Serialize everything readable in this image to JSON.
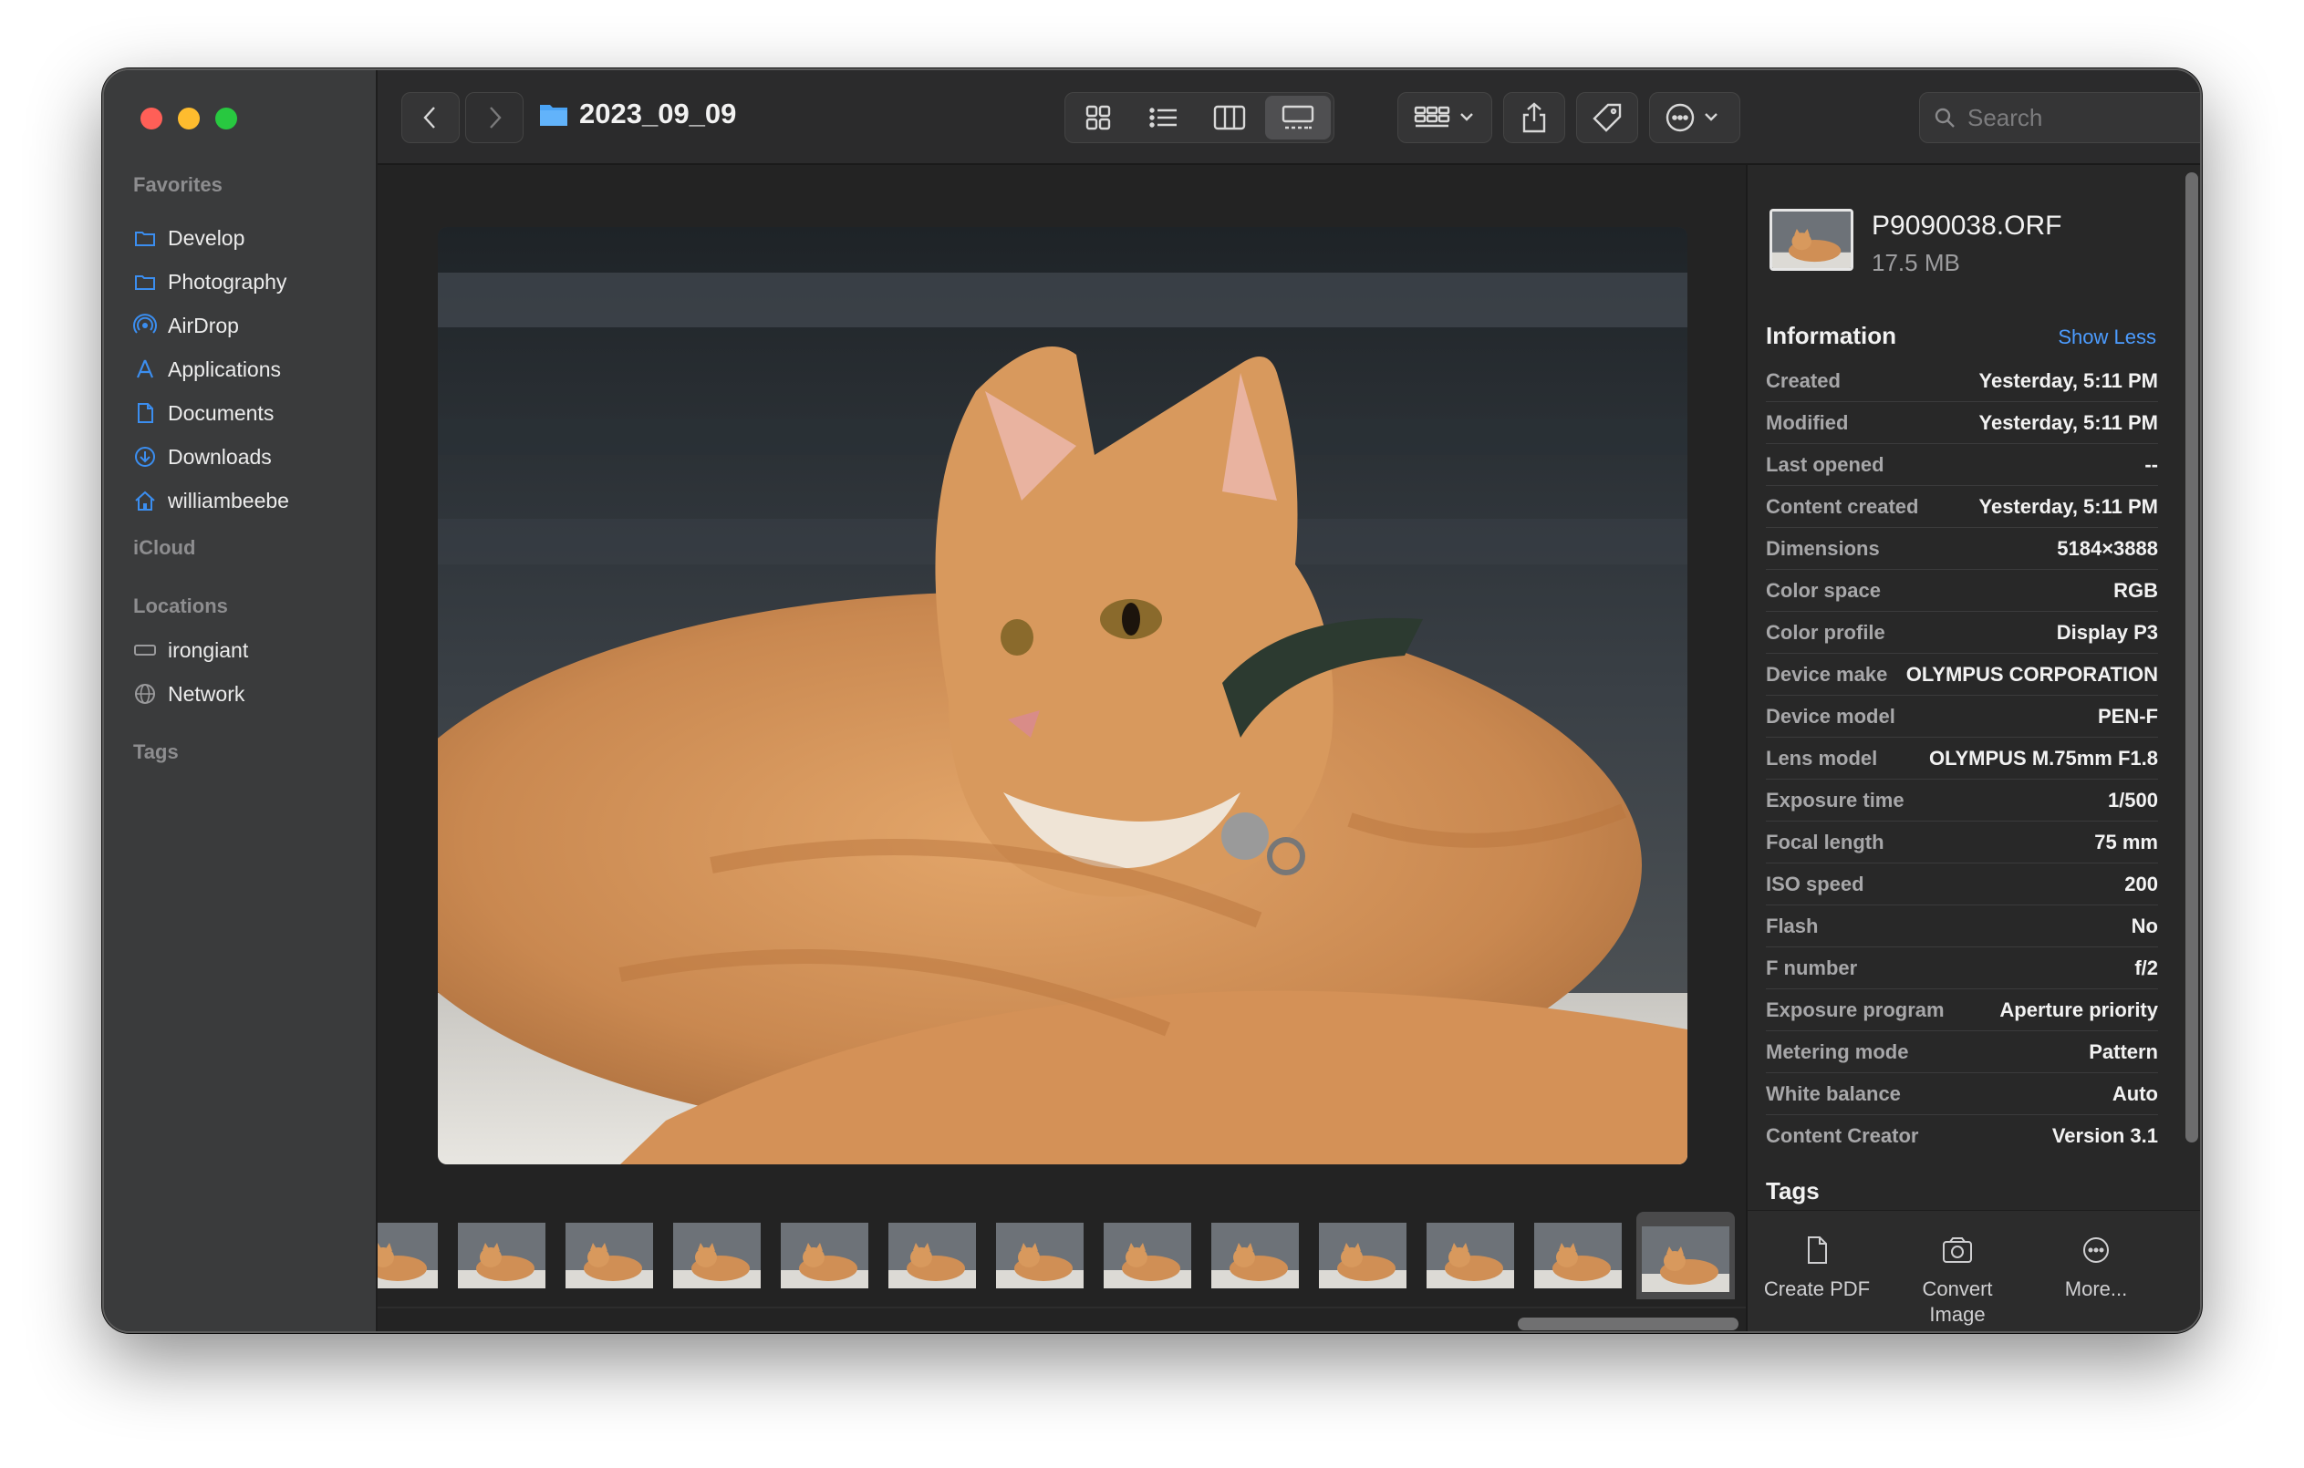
{
  "window": {
    "folder_title": "2023_09_09",
    "search_placeholder": "Search"
  },
  "sidebar": {
    "favorites_label": "Favorites",
    "favorites": [
      {
        "label": "Develop",
        "icon": "folder-icon"
      },
      {
        "label": "Photography",
        "icon": "folder-icon"
      },
      {
        "label": "AirDrop",
        "icon": "airdrop-icon"
      },
      {
        "label": "Applications",
        "icon": "applications-icon"
      },
      {
        "label": "Documents",
        "icon": "document-icon"
      },
      {
        "label": "Downloads",
        "icon": "download-icon"
      },
      {
        "label": "williambeebe",
        "icon": "home-icon"
      }
    ],
    "icloud_label": "iCloud",
    "locations_label": "Locations",
    "locations": [
      {
        "label": "irongiant",
        "icon": "drive-icon"
      },
      {
        "label": "Network",
        "icon": "globe-icon"
      }
    ],
    "tags_label": "Tags"
  },
  "inspector": {
    "file_name": "P9090038.ORF",
    "file_size": "17.5 MB",
    "info_title": "Information",
    "show_less": "Show Less",
    "rows": [
      {
        "key": "Created",
        "value": "Yesterday, 5:11 PM"
      },
      {
        "key": "Modified",
        "value": "Yesterday, 5:11 PM"
      },
      {
        "key": "Last opened",
        "value": "--"
      },
      {
        "key": "Content created",
        "value": "Yesterday, 5:11 PM"
      },
      {
        "key": "Dimensions",
        "value": "5184×3888"
      },
      {
        "key": "Color space",
        "value": "RGB"
      },
      {
        "key": "Color profile",
        "value": "Display P3"
      },
      {
        "key": "Device make",
        "value": "OLYMPUS CORPORATION"
      },
      {
        "key": "Device model",
        "value": "PEN-F"
      },
      {
        "key": "Lens model",
        "value": "OLYMPUS M.75mm F1.8"
      },
      {
        "key": "Exposure time",
        "value": "1/500"
      },
      {
        "key": "Focal length",
        "value": "75 mm"
      },
      {
        "key": "ISO speed",
        "value": "200"
      },
      {
        "key": "Flash",
        "value": "No"
      },
      {
        "key": "F number",
        "value": "f/2"
      },
      {
        "key": "Exposure program",
        "value": "Aperture priority"
      },
      {
        "key": "Metering mode",
        "value": "Pattern"
      },
      {
        "key": "White balance",
        "value": "Auto"
      },
      {
        "key": "Content Creator",
        "value": "Version 3.1"
      }
    ],
    "tags_title": "Tags",
    "actions": [
      {
        "label": "Create PDF",
        "icon": "document-icon"
      },
      {
        "label": "Convert Image",
        "icon": "photo-convert-icon"
      },
      {
        "label": "More...",
        "icon": "ellipsis-circle-icon"
      }
    ]
  },
  "colors": {
    "accent": "#4c9cff",
    "close": "#ff5f57",
    "minimize": "#febc2e",
    "maximize": "#28c840"
  }
}
